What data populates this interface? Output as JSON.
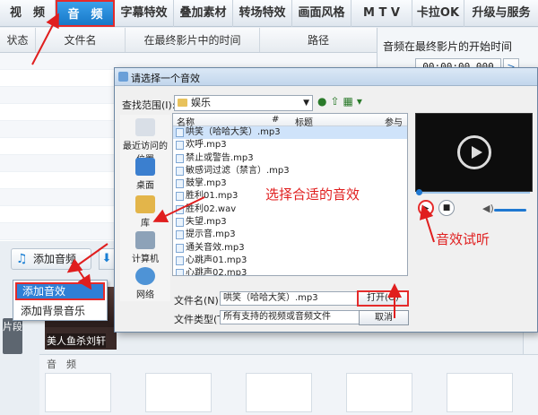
{
  "menu": {
    "tabs": [
      "视　频",
      "音　频",
      "字幕特效",
      "叠加素材",
      "转场特效",
      "画面风格",
      "M T V",
      "卡拉OK",
      "升级与服务"
    ],
    "active": 1
  },
  "list_columns": [
    "状态",
    "文件名",
    "在最终影片中的时间",
    "路径"
  ],
  "side": {
    "title": "音频在最终影片的开始时间",
    "time": "00:00:00.000",
    "btn": ">"
  },
  "add_audio": {
    "label": "添加音频",
    "icon": "music-note-icon"
  },
  "context_menu": [
    "添加音效",
    "添加背景音乐"
  ],
  "thumb_caption": "美人鱼杀刘轩",
  "pian_label": "片段",
  "audio_track_label": "音　频",
  "dialog": {
    "title": "请选择一个音效",
    "look_in_label": "查找范围(I):",
    "look_in_value": "娱乐",
    "places": [
      "最近访问的位置",
      "桌面",
      "库",
      "计算机",
      "网络"
    ],
    "columns": [
      "名称",
      "#",
      "标题",
      "参与"
    ],
    "files": [
      "哄笑（哈哈大笑）.mp3",
      "欢呼.mp3",
      "禁止或警告.mp3",
      "敏感词过滤（禁言）.mp3",
      "鼓掌.mp3",
      "胜利01.mp3",
      "胜利02.wav",
      "失望.mp3",
      "提示音.mp3",
      "通关音效.mp3",
      "心跳声01.mp3",
      "心跳声02.mp3"
    ],
    "selected_file": 0,
    "filename_label": "文件名(N):",
    "filename_value": "哄笑（哈哈大笑）.mp3",
    "filetype_label": "文件类型(T):",
    "filetype_value": "所有支持的视频或音频文件",
    "open_label": "打开(O)",
    "cancel_label": "取消"
  },
  "annotations": {
    "choose_sound": "选择合适的音效",
    "preview_sound": "音效试听"
  },
  "colors": {
    "accent": "#1f78d1",
    "annotation_red": "#e01e1e"
  }
}
